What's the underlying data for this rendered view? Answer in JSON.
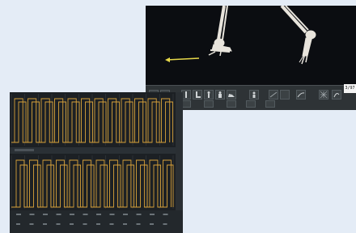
{
  "viewer": {
    "frame_counter": "3/97",
    "toolbar_icons": [
      "view-front-icon",
      "view-side-icon",
      "skeleton-foot-icon",
      "skeleton-leg-icon",
      "figure-icon",
      "person-icon",
      "shoe-icon",
      "model-icon",
      "plane-icon",
      "grid-icon",
      "curve-icon",
      "mesh-icon",
      "rotate-icon"
    ],
    "colors": {
      "background": "#0b0d11",
      "bone": "#e8e4dc",
      "arrow": "#e6d84a"
    }
  },
  "charts_panel": {
    "top_legend": "",
    "colors": {
      "background": "#1c2024",
      "line": "#d8a23a",
      "grid": "#3b4045"
    }
  }
}
